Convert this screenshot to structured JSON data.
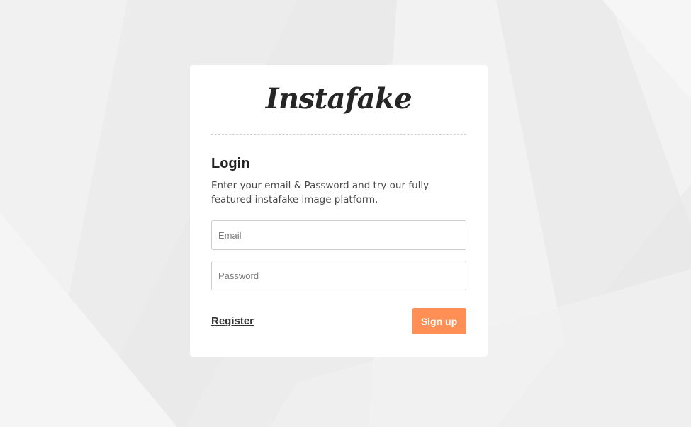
{
  "brand": {
    "logo_text": "Instafake"
  },
  "login": {
    "title": "Login",
    "description": "Enter your email & Password and try our fully featured instafake image platform.",
    "email_placeholder": "Email",
    "password_placeholder": "Password",
    "register_label": "Register",
    "signup_label": "Sign up"
  },
  "colors": {
    "background": "#ececec",
    "card": "#ffffff",
    "accent_button": "#ff8f55",
    "text_dark": "#222222"
  }
}
